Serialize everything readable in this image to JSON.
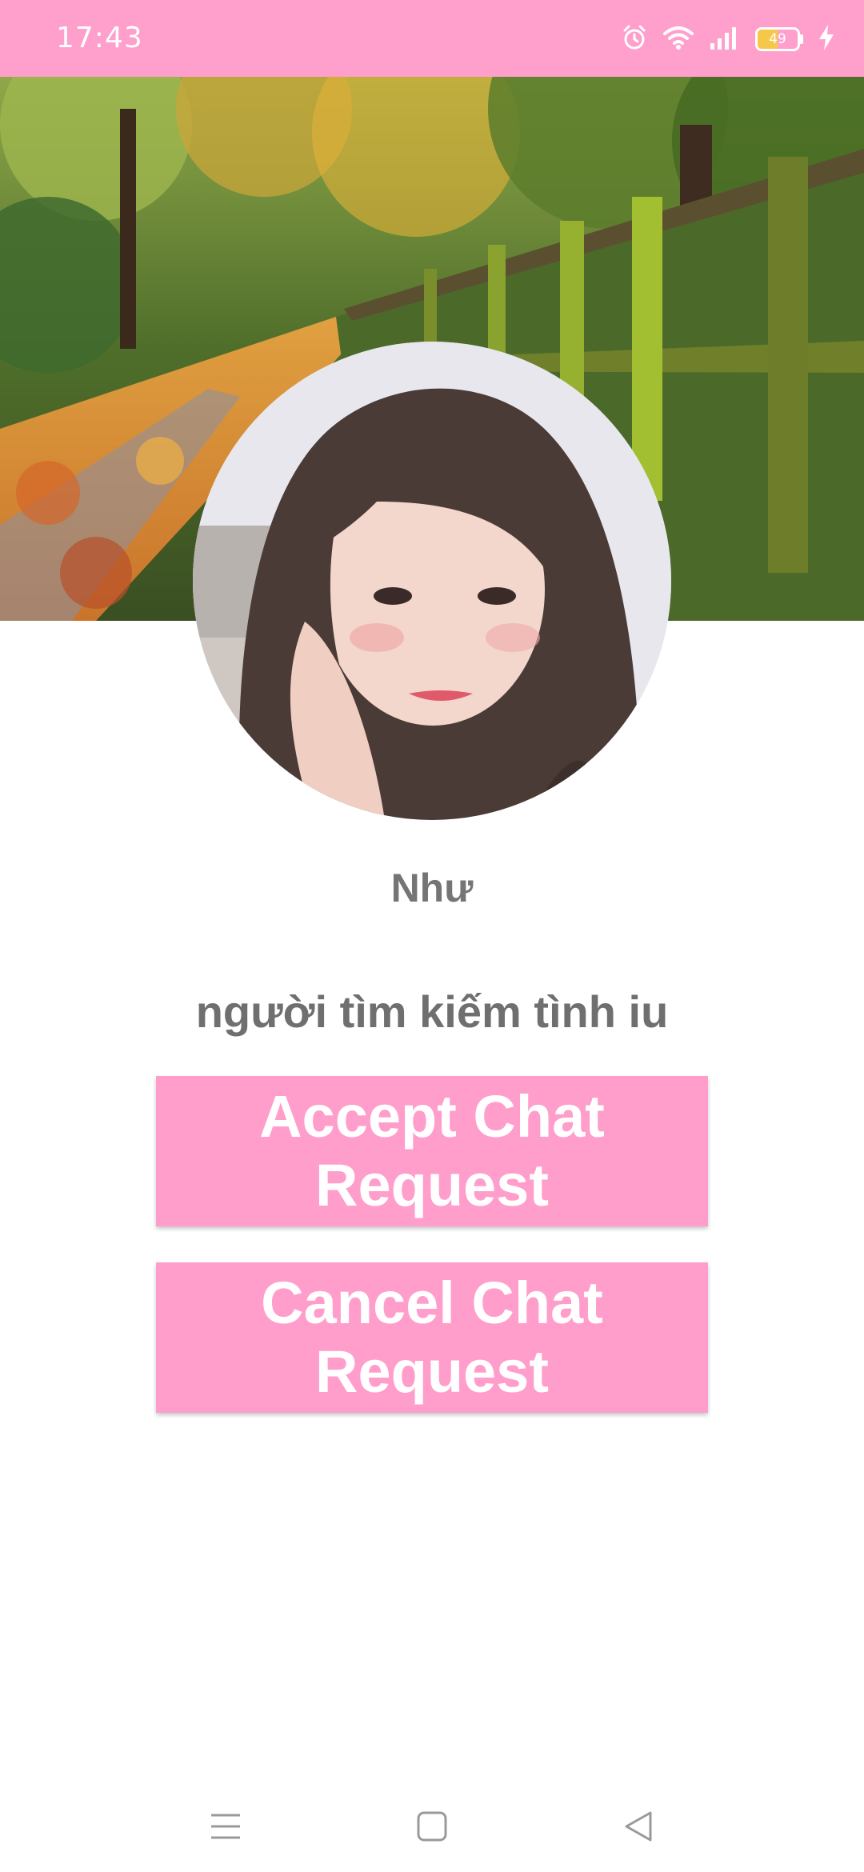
{
  "status_bar": {
    "time": "17:43",
    "battery_level": "49",
    "battery_fraction": 0.49,
    "icons": [
      "alarm-icon",
      "wifi-icon",
      "signal-icon",
      "battery-icon",
      "charging-icon"
    ],
    "background_color": "#ff9fcc"
  },
  "profile": {
    "name": "Như",
    "status": "người tìm kiếm tình iu"
  },
  "buttons": {
    "accept_label": "Accept Chat Request",
    "cancel_label": "Cancel Chat Request",
    "color": "#ff9dcb"
  },
  "nav_bar": {
    "icons": [
      "menu-icon",
      "home-icon",
      "back-icon"
    ]
  }
}
